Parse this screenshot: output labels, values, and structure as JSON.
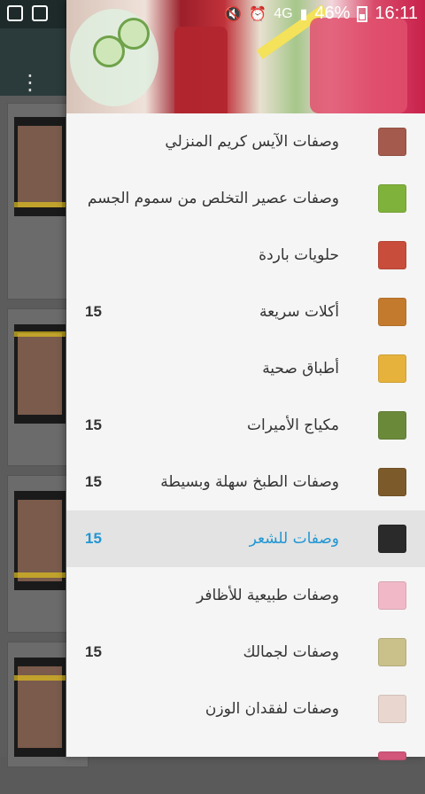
{
  "status_bar": {
    "battery_percent": "46%",
    "time": "16:11",
    "signal_label": "4G"
  },
  "drawer": {
    "items": [
      {
        "label": "وصفات الآيس كريم المنزلي",
        "count": "",
        "icon": "ice-cream-icon",
        "color": "#a45a4c",
        "active": false
      },
      {
        "label": "وصفات عصير التخلص من سموم الجسم",
        "count": "",
        "icon": "detox-juice-icon",
        "color": "#7fb23a",
        "active": false
      },
      {
        "label": "حلويات باردة",
        "count": "",
        "icon": "cold-dessert-icon",
        "color": "#c94d3b",
        "active": false
      },
      {
        "label": "أكلات سريعة",
        "count": "15",
        "icon": "fast-food-icon",
        "color": "#c47a2d",
        "active": false
      },
      {
        "label": "أطباق صحية",
        "count": "",
        "icon": "healthy-dish-icon",
        "color": "#e6b23c",
        "active": false
      },
      {
        "label": "مكياج الأميرات",
        "count": "15",
        "icon": "makeup-eye-icon",
        "color": "#6a8a3a",
        "active": false
      },
      {
        "label": "وصفات الطبخ سهلة وبسيطة",
        "count": "15",
        "icon": "cooking-icon",
        "color": "#7d5a2a",
        "active": false
      },
      {
        "label": "وصفات للشعر",
        "count": "15",
        "icon": "hair-icon",
        "color": "#2a2a2a",
        "active": true
      },
      {
        "label": "وصفات طبيعية للأظافر",
        "count": "",
        "icon": "nails-icon",
        "color": "#f1b9c8",
        "active": false
      },
      {
        "label": "وصفات لجمالك",
        "count": "15",
        "icon": "beauty-mask-icon",
        "color": "#c9c08a",
        "active": false
      },
      {
        "label": "وصفات لفقدان الوزن",
        "count": "",
        "icon": "weight-loss-icon",
        "color": "#e9d6cf",
        "active": false
      },
      {
        "label": "",
        "count": "",
        "icon": "next-item-icon",
        "color": "#d1567a",
        "active": false
      }
    ]
  }
}
